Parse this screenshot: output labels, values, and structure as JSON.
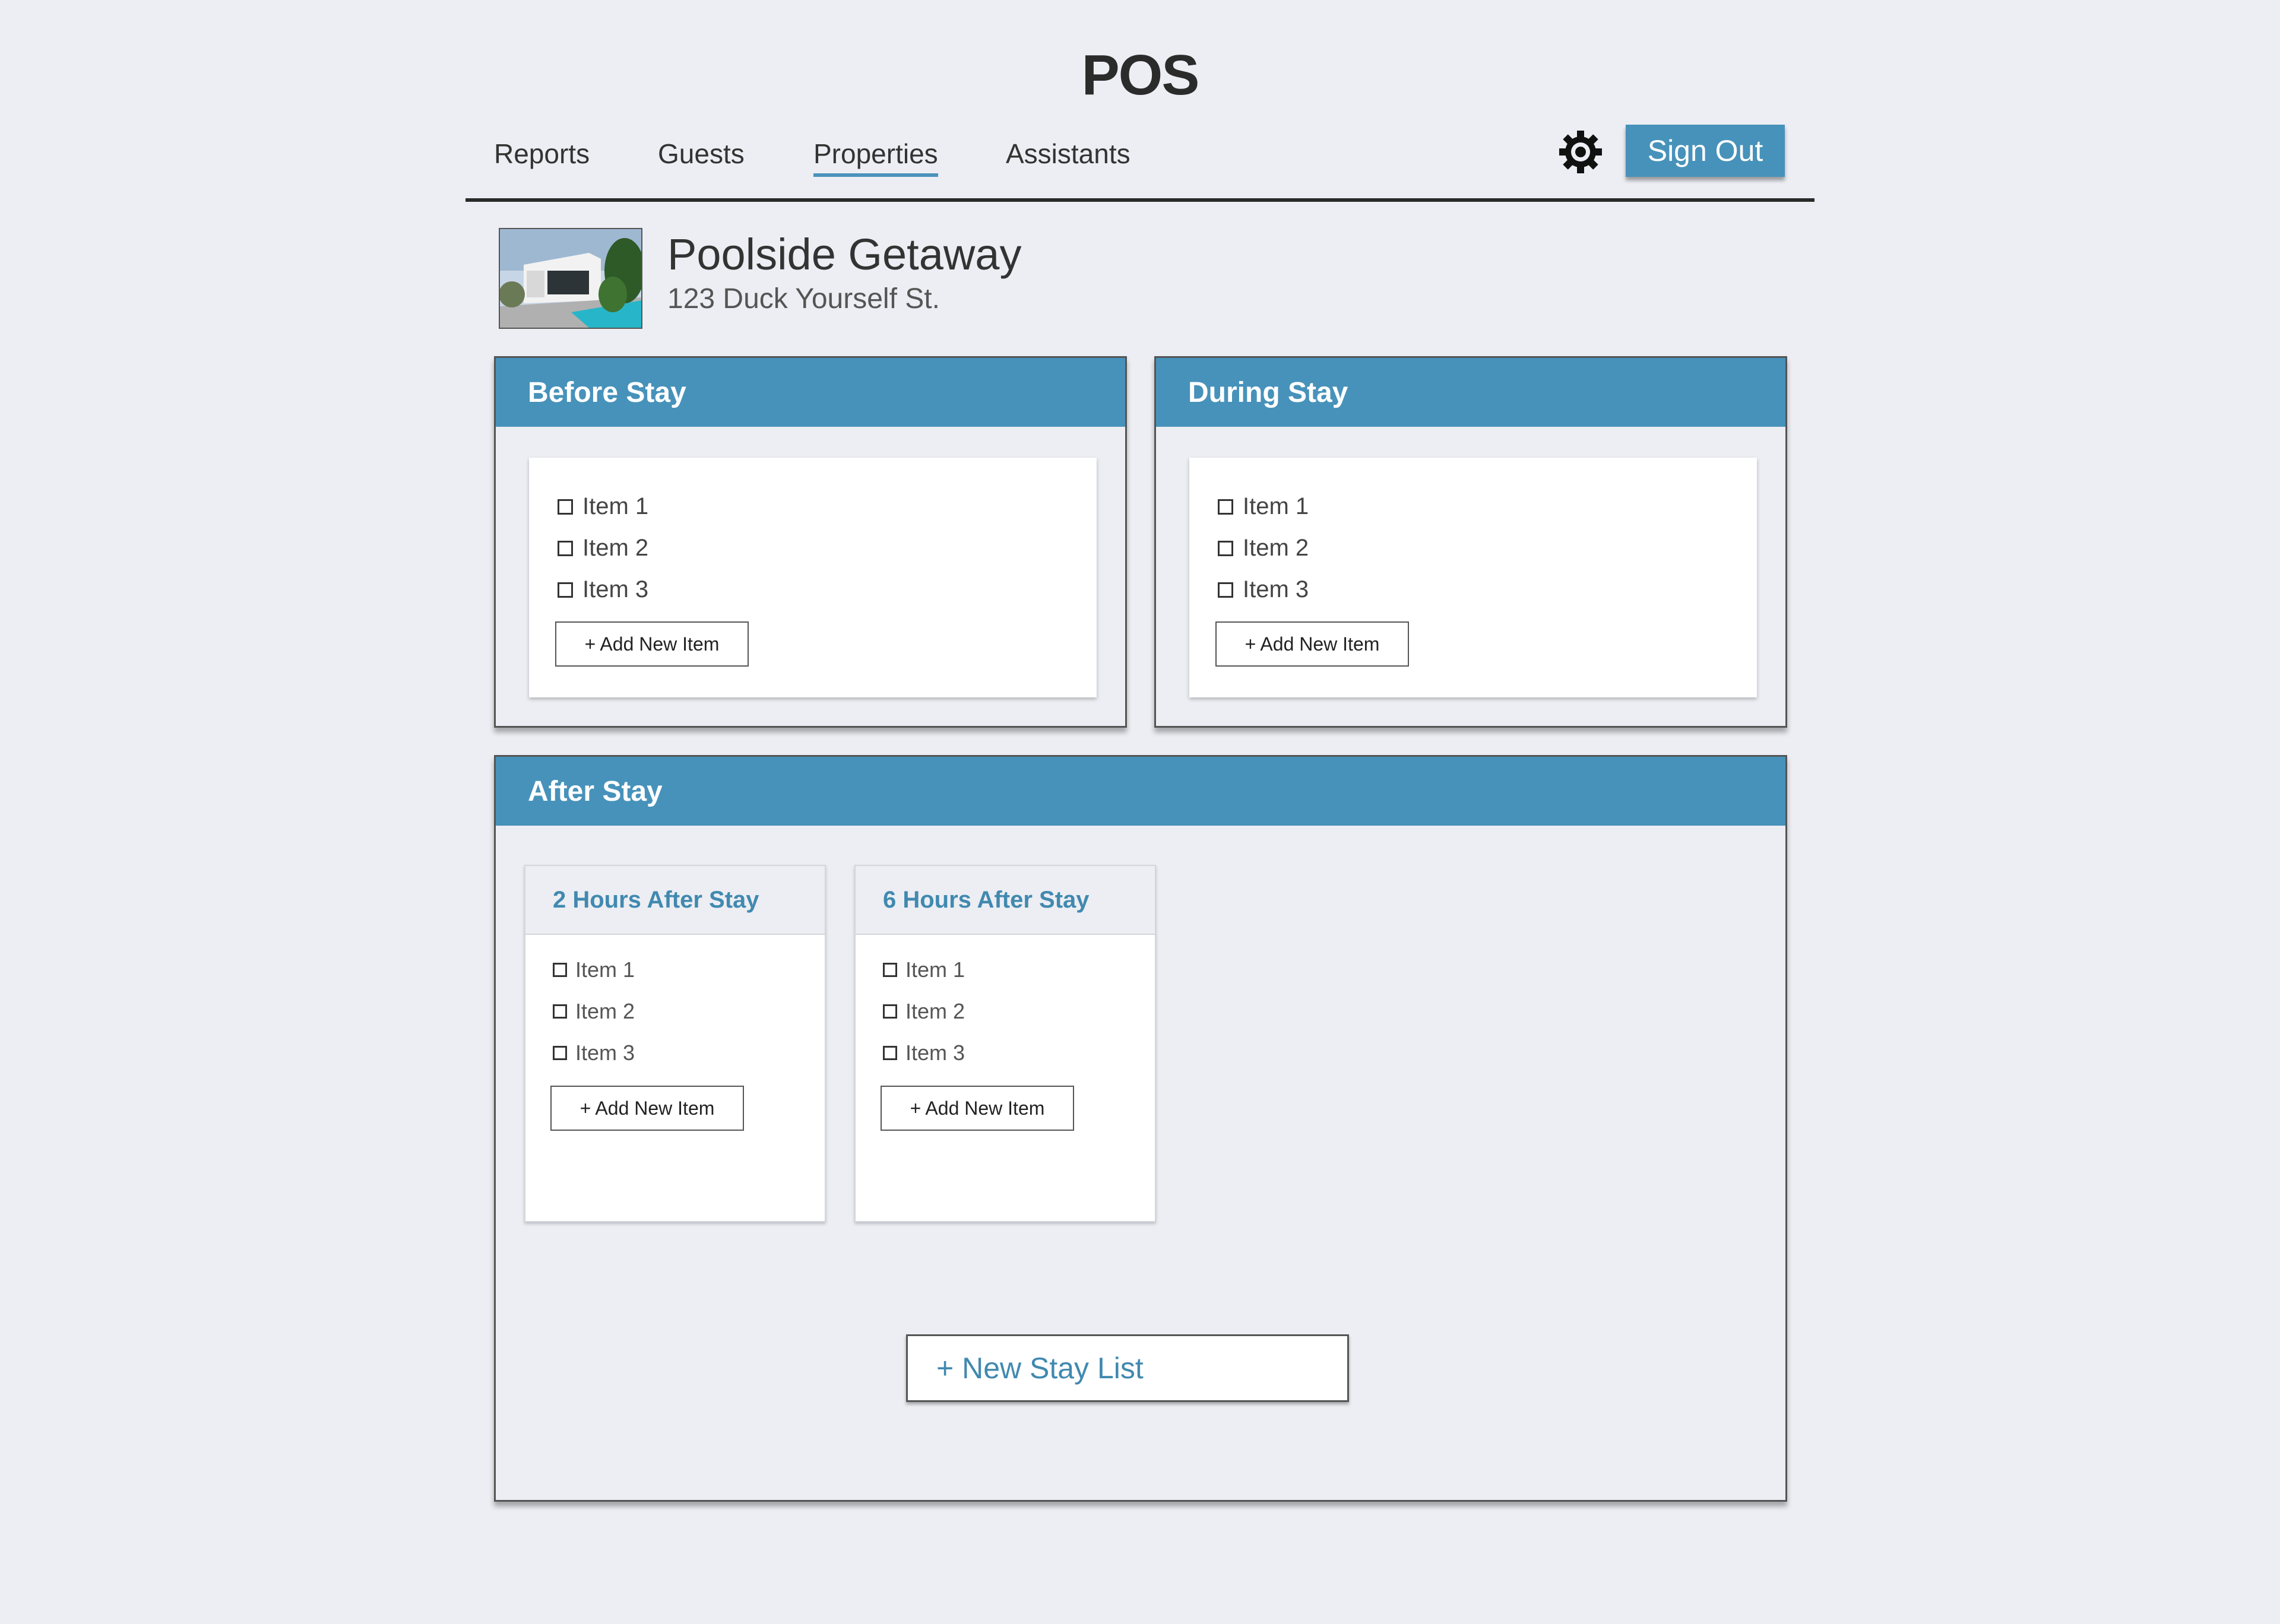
{
  "app": {
    "title": "POS"
  },
  "nav": {
    "tabs": [
      {
        "label": "Reports"
      },
      {
        "label": "Guests"
      },
      {
        "label": "Properties",
        "active": true
      },
      {
        "label": "Assistants"
      }
    ],
    "settings_icon": "gear-icon",
    "sign_out_label": "Sign Out"
  },
  "property": {
    "name": "Poolside Getaway",
    "address": "123 Duck Yourself St.",
    "thumbnail_icon": "house-photo"
  },
  "before_stay": {
    "title": "Before Stay",
    "items": [
      "Item 1",
      "Item 2",
      "Item 3"
    ],
    "add_label": "+ Add New Item"
  },
  "during_stay": {
    "title": "During Stay",
    "items": [
      "Item 1",
      "Item 2",
      "Item 3"
    ],
    "add_label": "+ Add New Item"
  },
  "after_stay": {
    "title": "After Stay",
    "lists": [
      {
        "title": "2 Hours After Stay",
        "items": [
          "Item 1",
          "Item 2",
          "Item 3"
        ],
        "add_label": "+ Add New Item"
      },
      {
        "title": "6 Hours After Stay",
        "items": [
          "Item 1",
          "Item 2",
          "Item 3"
        ],
        "add_label": "+ Add New Item"
      }
    ],
    "new_list_label": "+ New Stay List"
  },
  "colors": {
    "accent": "#4792ba",
    "background": "#eceef3",
    "link": "#4189b0"
  }
}
